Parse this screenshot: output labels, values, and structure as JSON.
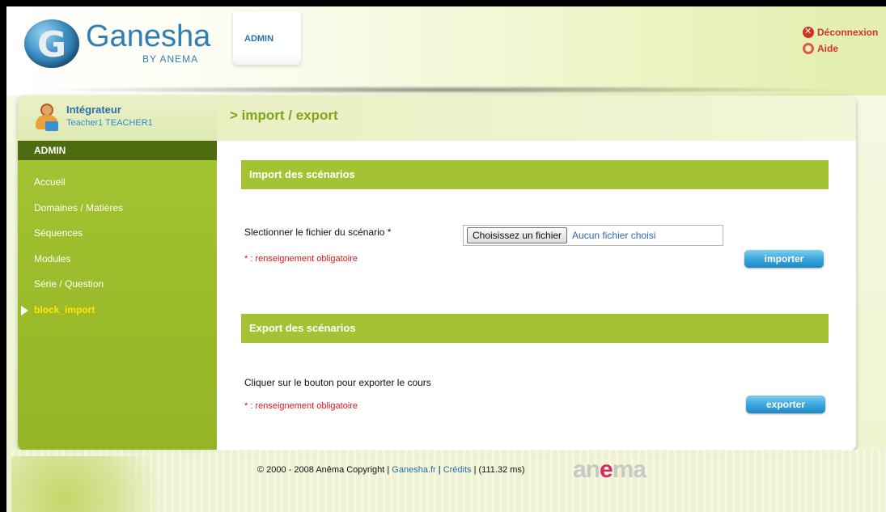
{
  "header": {
    "logo_name": "Ganesha",
    "logo_sub": "BY ANEMA",
    "logo_letter": "G",
    "admin_tab": "ADMIN",
    "links": {
      "logout": "Déconnexion",
      "help": "Aide"
    }
  },
  "user": {
    "role": "Intégrateur",
    "name": "Teacher1 TEACHER1"
  },
  "sidebar": {
    "heading": "ADMIN",
    "items": [
      {
        "label": "Accueil"
      },
      {
        "label": "Domaines / Matières"
      },
      {
        "label": "Séquences"
      },
      {
        "label": "Modules"
      },
      {
        "label": "Série / Question"
      },
      {
        "label": "block_import",
        "active": true
      }
    ]
  },
  "page": {
    "title": "> import / export"
  },
  "import": {
    "header": "Import des scénarios",
    "file_label": "Slectionner le fichier du scénario *",
    "file_button": "Choisissez un fichier",
    "file_status": "Aucun fichier choisi",
    "required_note": "* : renseignement obligatoire",
    "button": "importer"
  },
  "export": {
    "header": "Export des scénarios",
    "instructions": "Cliquer sur le bouton pour exporter le cours",
    "required_note": "* : renseignement obligatoire",
    "button": "exporter"
  },
  "footer": {
    "copyright": "© 2000 - 2008 Anêma Copyright | ",
    "link_site": "Ganesha.fr",
    "sep1": " | ",
    "link_credits": "Crédits",
    "timing": " | (111.32 ms)",
    "logo_a": "an",
    "logo_e": "e",
    "logo_rest": "ma"
  },
  "colors": {
    "accent_green": "#a4c233",
    "link_blue": "#2c6fa8",
    "required_red": "#e0131a",
    "button_blue": "#3da7dd"
  }
}
